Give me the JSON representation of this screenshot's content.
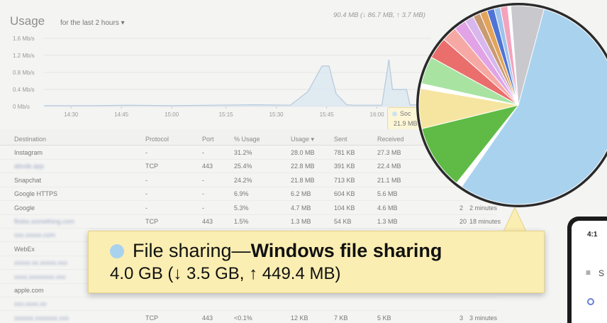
{
  "header": {
    "title": "Usage",
    "range": "for the last 2 hours ▾",
    "totals": "90.4 MB (↓ 86.7 MB, ↑ 3.7 MB)"
  },
  "chart_data": {
    "type": "area",
    "y_ticks": [
      "1.6 Mb/s",
      "1.2 Mb/s",
      "0.8 Mb/s",
      "0.4 Mb/s",
      "0 Mb/s"
    ],
    "x_ticks": [
      "14:30",
      "14:45",
      "15:00",
      "15:15",
      "15:30",
      "15:45",
      "16:00"
    ],
    "ylim": [
      0,
      1.6
    ],
    "series": [
      {
        "values": [
          [
            0,
            0.02
          ],
          [
            14,
            0.02
          ],
          [
            24,
            0.03
          ],
          [
            36,
            0.02
          ],
          [
            48,
            0.03
          ],
          [
            60,
            0.04
          ],
          [
            70,
            0.03
          ],
          [
            75,
            0.35
          ],
          [
            79,
            0.95
          ],
          [
            81,
            0.95
          ],
          [
            83,
            0.3
          ],
          [
            86,
            0.04
          ],
          [
            88,
            0.03
          ],
          [
            96,
            0.03
          ],
          [
            98,
            1.1
          ],
          [
            99,
            0.4
          ],
          [
            103,
            0.4
          ],
          [
            104,
            0.04
          ],
          [
            110,
            0.03
          ]
        ]
      }
    ],
    "grid": true
  },
  "tooltip": {
    "label": "Soc",
    "value": "21.9 MB"
  },
  "table": {
    "headers": [
      "Destination",
      "Protocol",
      "Port",
      "% Usage",
      "Usage ▾",
      "Sent",
      "Received"
    ],
    "rows": [
      {
        "dest": "Instagram",
        "proto": "-",
        "port": "-",
        "pct": "31.2%",
        "use": "28.0 MB",
        "sent": "781 KB",
        "recv": "27.3 MB",
        "x1": "",
        "x2": "",
        "blur": false
      },
      {
        "dest": "abcde.app",
        "proto": "TCP",
        "port": "443",
        "pct": "25.4%",
        "use": "22.8 MB",
        "sent": "391 KB",
        "recv": "22.4 MB",
        "x1": "",
        "x2": "",
        "blur": true
      },
      {
        "dest": "Snapchat",
        "proto": "-",
        "port": "-",
        "pct": "24.2%",
        "use": "21.8 MB",
        "sent": "713 KB",
        "recv": "21.1 MB",
        "x1": "",
        "x2": "",
        "blur": false
      },
      {
        "dest": "Google HTTPS",
        "proto": "-",
        "port": "-",
        "pct": "6.9%",
        "use": "6.2 MB",
        "sent": "604 KB",
        "recv": "5.6 MB",
        "x1": "",
        "x2": "",
        "blur": false
      },
      {
        "dest": "Google",
        "proto": "-",
        "port": "-",
        "pct": "5.3%",
        "use": "4.7 MB",
        "sent": "104 KB",
        "recv": "4.6 MB",
        "x1": "2",
        "x2": "2 minutes",
        "blur": false
      },
      {
        "dest": "fbsbx.something.com",
        "proto": "TCP",
        "port": "443",
        "pct": "1.5%",
        "use": "1.3 MB",
        "sent": "54 KB",
        "recv": "1.3 MB",
        "x1": "20",
        "x2": "18 minutes",
        "blur": true
      },
      {
        "dest": "xxx.xxxxx.com",
        "proto": "",
        "port": "",
        "pct": "",
        "use": "",
        "sent": "",
        "recv": "",
        "x1": "",
        "x2": "",
        "blur": true
      },
      {
        "dest": "WebEx",
        "proto": "",
        "port": "",
        "pct": "",
        "use": "",
        "sent": "",
        "recv": "",
        "x1": "",
        "x2": "",
        "blur": false
      },
      {
        "dest": "xxxxx.xx.xxxxx.xxx",
        "proto": "",
        "port": "",
        "pct": "",
        "use": "",
        "sent": "",
        "recv": "",
        "x1": "",
        "x2": "",
        "blur": true
      },
      {
        "dest": "xxxx.xxxxxxxx.xxx",
        "proto": "",
        "port": "",
        "pct": "",
        "use": "",
        "sent": "",
        "recv": "",
        "x1": "",
        "x2": "",
        "blur": true
      },
      {
        "dest": "apple.com",
        "proto": "",
        "port": "",
        "pct": "",
        "use": "",
        "sent": "",
        "recv": "",
        "x1": "",
        "x2": "",
        "blur": false
      },
      {
        "dest": "xxx.xxxx.xx",
        "proto": "",
        "port": "",
        "pct": "",
        "use": "",
        "sent": "",
        "recv": "",
        "x1": "",
        "x2": "",
        "blur": true
      },
      {
        "dest": "xxxxxx.xxxxxxx.xxx",
        "proto": "TCP",
        "port": "443",
        "pct": "<0.1%",
        "use": "12 KB",
        "sent": "7 KB",
        "recv": "5 KB",
        "x1": "3",
        "x2": "3 minutes",
        "blur": true
      }
    ]
  },
  "callout": {
    "prefix": "File sharing—",
    "bold": "Windows file sharing",
    "line2": "4.0 GB (↓ 3.5 GB, ↑ 449.4 MB)",
    "dot_color": "#a9d2ee"
  },
  "pie": {
    "slices": [
      {
        "fraction": 0.6,
        "color": "#a9d2ee"
      },
      {
        "fraction": 0.01,
        "color": "#ffffff"
      },
      {
        "fraction": 0.105,
        "color": "#5fbb45"
      },
      {
        "fraction": 0.065,
        "color": "#f6e5a0"
      },
      {
        "fraction": 0.008,
        "color": "#ffffff"
      },
      {
        "fraction": 0.045,
        "color": "#a8e3a2"
      },
      {
        "fraction": 0.035,
        "color": "#ea6e6b"
      },
      {
        "fraction": 0.025,
        "color": "#f6a9a4"
      },
      {
        "fraction": 0.02,
        "color": "#e1a3e6"
      },
      {
        "fraction": 0.015,
        "color": "#d7b7ec"
      },
      {
        "fraction": 0.012,
        "color": "#c99b73"
      },
      {
        "fraction": 0.012,
        "color": "#e3a45a"
      },
      {
        "fraction": 0.012,
        "color": "#4f74d6"
      },
      {
        "fraction": 0.01,
        "color": "#9fc3ea"
      },
      {
        "fraction": 0.012,
        "color": "#f4a3bd"
      },
      {
        "fraction": 0.005,
        "color": "#ffffff"
      },
      {
        "fraction": 0.054,
        "color": "#c8c8cd"
      }
    ]
  },
  "phone": {
    "time": "4:1",
    "menu_icon": "≡",
    "letter": "S"
  }
}
